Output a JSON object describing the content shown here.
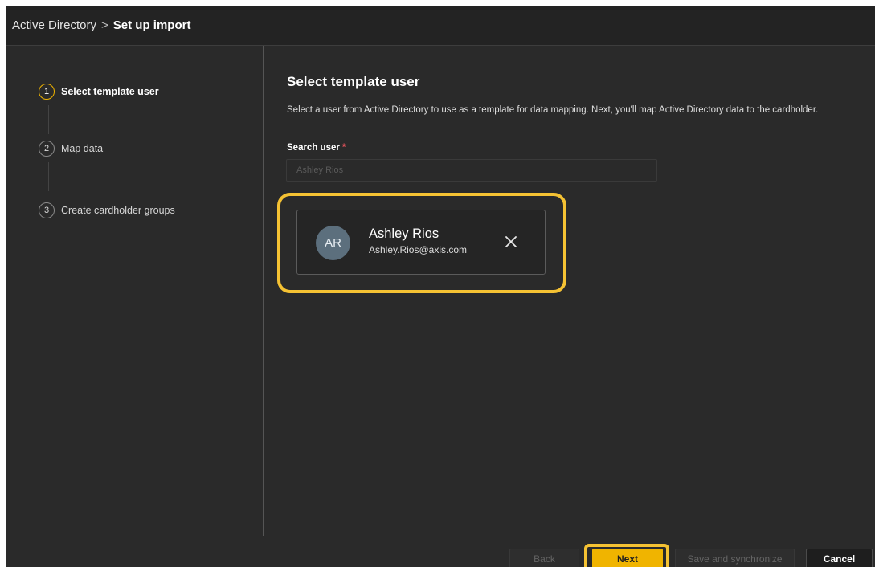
{
  "breadcrumb": {
    "parent": "Active Directory",
    "separator": ">",
    "current": "Set up import"
  },
  "steps": [
    {
      "number": "1",
      "label": "Select template user",
      "active": true
    },
    {
      "number": "2",
      "label": "Map data",
      "active": false
    },
    {
      "number": "3",
      "label": "Create cardholder groups",
      "active": false
    }
  ],
  "main": {
    "title": "Select template user",
    "description": "Select a user from Active Directory to use as a template for data mapping. Next, you'll map Active Directory data to the cardholder.",
    "search_label": "Search user",
    "required_marker": "*",
    "search_placeholder": "Ashley Rios"
  },
  "selected_user": {
    "initials": "AR",
    "name": "Ashley Rios",
    "email": "Ashley.Rios@axis.com",
    "remove_icon": "close-icon"
  },
  "footer": {
    "back": "Back",
    "next": "Next",
    "save_sync": "Save and synchronize",
    "cancel": "Cancel"
  },
  "colors": {
    "accent": "#f0b400",
    "highlight": "#f5c233",
    "background": "#2a2a2a",
    "avatar": "#5c6f7d",
    "required": "#e0525b"
  }
}
